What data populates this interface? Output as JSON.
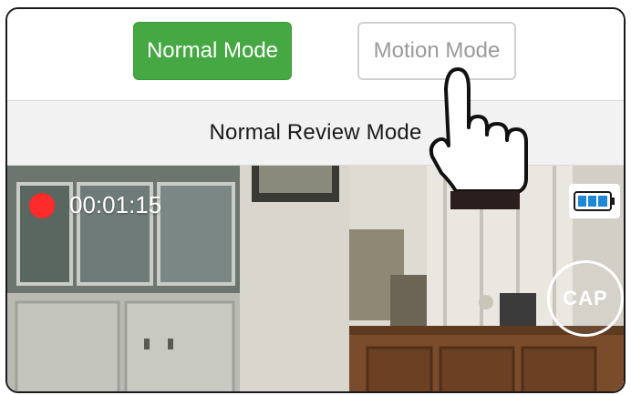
{
  "mode_toggle": {
    "normal_label": "Normal Mode",
    "motion_label": "Motion Mode",
    "active": "Normal Mode",
    "active_color": "#45a842"
  },
  "review_bar": {
    "title": "Normal Review Mode"
  },
  "video": {
    "recording_indicator_color": "#ff2a2a",
    "elapsed_time": "00:01:15",
    "battery_icon": "battery-full-icon",
    "capture_label": "CAP"
  },
  "overlay": {
    "pointer_icon": "tap-hand-icon"
  }
}
